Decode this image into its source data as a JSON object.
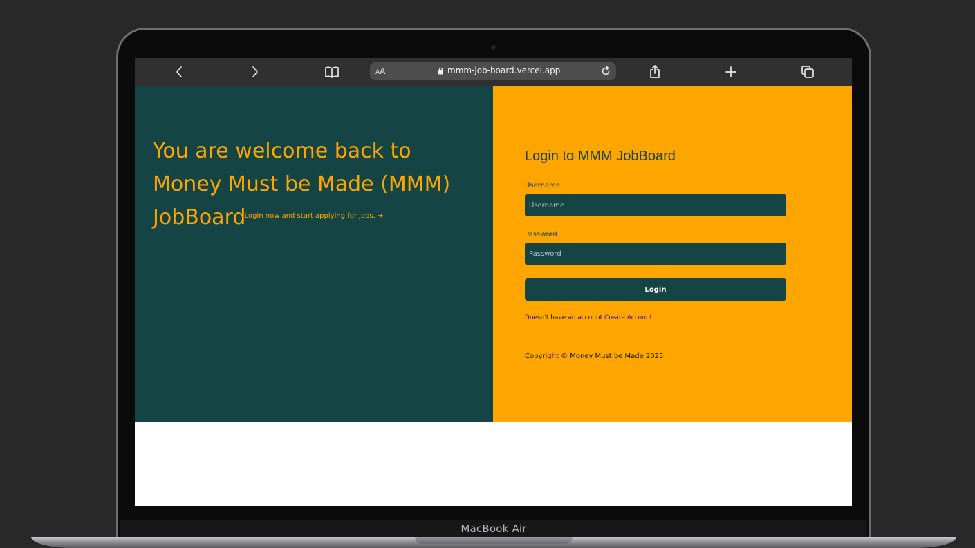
{
  "device": {
    "brand_label": "MacBook Air"
  },
  "browser": {
    "reader_label_small": "A",
    "reader_label_large": "A",
    "url": "mmm-job-board.vercel.app",
    "icons": [
      "back-icon",
      "forward-icon",
      "bookmarks-icon",
      "lock-icon",
      "reload-icon",
      "share-icon",
      "new-tab-icon",
      "tabs-icon"
    ]
  },
  "hero": {
    "title": "You are welcome back to Money Must be Made (MMM) JobBoard",
    "subtitle": "Login now and start applying for jobs.",
    "subtitle_arrow": "➔",
    "background_color": "#144443",
    "accent_color": "#ffa500"
  },
  "login_form": {
    "title": "Login to MMM JobBoard",
    "username_label": "Username",
    "username_placeholder": "Username",
    "username_value": "",
    "password_label": "Password",
    "password_placeholder": "Password",
    "password_value": "",
    "submit_label": "Login",
    "no_account_text": "Doesn't have an account",
    "create_account_link": "Create Account",
    "background_color": "#ffa500",
    "link_color": "#3b13d6"
  },
  "footer": {
    "copyright": "Copyright © Money Must be Made 2025"
  }
}
